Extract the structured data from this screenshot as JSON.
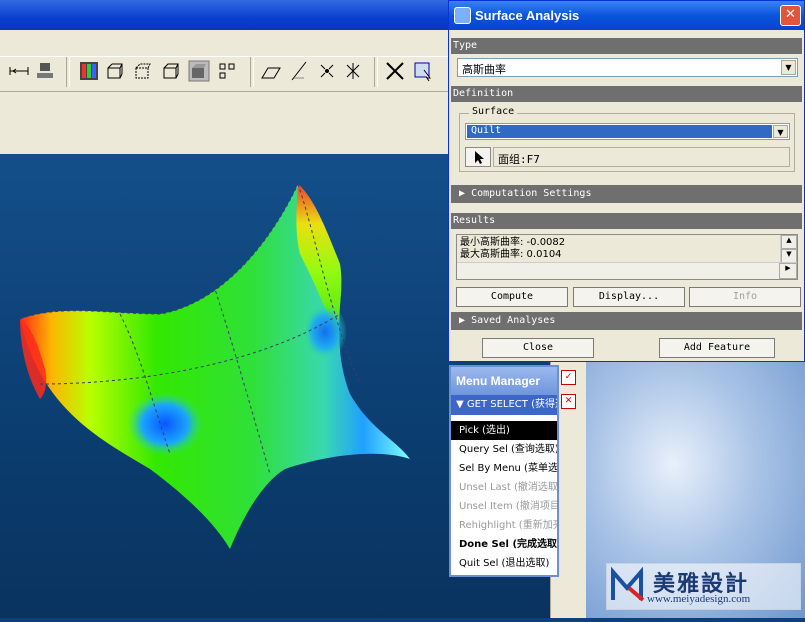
{
  "surface_analysis": {
    "title": "Surface Analysis",
    "type_label": "Type",
    "type_value": "高斯曲率",
    "definition_label": "Definition",
    "surface_label": "Surface",
    "surface_value": "Quilt",
    "selected_item": "面组:F7",
    "computation_settings": "Computation Settings",
    "results_label": "Results",
    "result_min": "最小高斯曲率: -0.0082",
    "result_max": "最大高斯曲率: 0.0104",
    "buttons": {
      "compute": "Compute",
      "display": "Display...",
      "info": "Info"
    },
    "saved_analyses": "Saved Analyses",
    "close": "Close",
    "add_feature": "Add Feature"
  },
  "menu_manager": {
    "title": "Menu Manager",
    "submenu": "GET SELECT (获得选取)",
    "items": [
      {
        "label": "Pick (选出)"
      },
      {
        "label": "Query Sel (查询选取)"
      },
      {
        "label": "Sel By Menu (菜单选取)"
      },
      {
        "label": "Unsel Last (撤消选取)"
      },
      {
        "label": "Unsel Item (撤消项目)"
      },
      {
        "label": "Rehighlight (重新加亮)"
      },
      {
        "label": "Done Sel (完成选取)"
      },
      {
        "label": "Quit Sel (退出选取)"
      }
    ]
  },
  "watermark": {
    "brand": "美雅設計",
    "url": "www.meiyadesign.com"
  }
}
